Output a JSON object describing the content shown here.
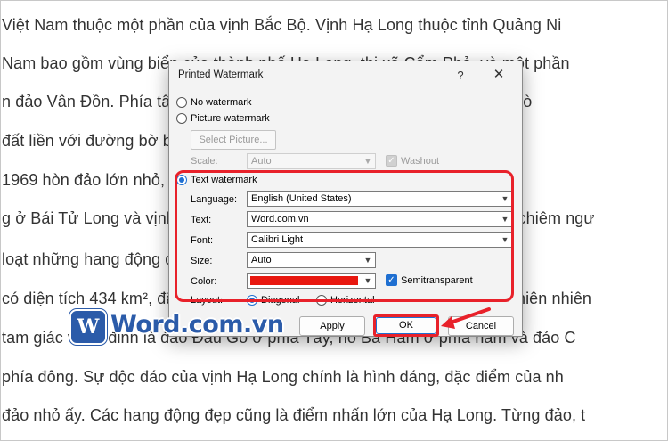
{
  "document": {
    "lines": [
      "Việt Nam thuộc một phần của vịnh Bắc Bộ. Vịnh Hạ Long thuộc tỉnh Quảng Ni",
      "Nam bao gồm vùng biển của thành phố Hạ Long, thị xã Cẩm Phả, và một phần",
      "n đảo Vân Đồn. Phía tây nam và phía đông vịnh Hạ Long là biển, phần cò",
      "đất liền với đường bờ biển dài 120 km, có diện tích 1553 km². Vịnh Hạ",
      "1969 hòn đảo lớn nhỏ, trong đó có 980 đảo đá vôi và đảo phiến thạch",
      "g ở Bái Tử Long và vịnh Hạ Long, chỉ có một số đảo có người tham gia chiêm ngư",
      "loạt những hang động đẹp nổi tiếng. Vịnh Hạ Long đã được UNESCO c",
      "có diện tích 434 km², đã được UNESCO nhiều lần công nhận là di sản thiên nhiên",
      "tam giác với 3 đỉnh là đảo Đầu Gỗ ở phía Tây, hồ Ba Hầm ở phía nam và đảo C",
      "phía đông. Sự độc đáo của vịnh Hạ Long chính là hình dáng, đặc điểm của nh",
      "đảo nhỏ ấy. Các hang động đẹp cũng là điểm nhấn lớn của Hạ Long. Từng đảo, t"
    ]
  },
  "dialog": {
    "title": "Printed Watermark",
    "help": "?",
    "close": "✕",
    "no_watermark": "No watermark",
    "picture_watermark": "Picture watermark",
    "select_picture": "Select Picture...",
    "scale_label": "Scale:",
    "scale_value": "Auto",
    "washout_label": "Washout",
    "text_watermark": "Text watermark",
    "language_label": "Language:",
    "language_value": "English (United States)",
    "text_label": "Text:",
    "text_value": "Word.com.vn",
    "font_label": "Font:",
    "font_value": "Calibri Light",
    "size_label": "Size:",
    "size_value": "Auto",
    "color_label": "Color:",
    "color_value": "#e8170f",
    "semitransparent_label": "Semitransparent",
    "layout_label": "Layout:",
    "diagonal_label": "Diagonal",
    "horizontal_label": "Horizontal",
    "apply": "Apply",
    "ok": "OK",
    "cancel": "Cancel"
  },
  "logo": {
    "badge": "W",
    "text": "Word.com.vn"
  },
  "colors": {
    "highlight": "#e8212a",
    "accent": "#1f6fd1",
    "brand": "#2b5ba9"
  }
}
